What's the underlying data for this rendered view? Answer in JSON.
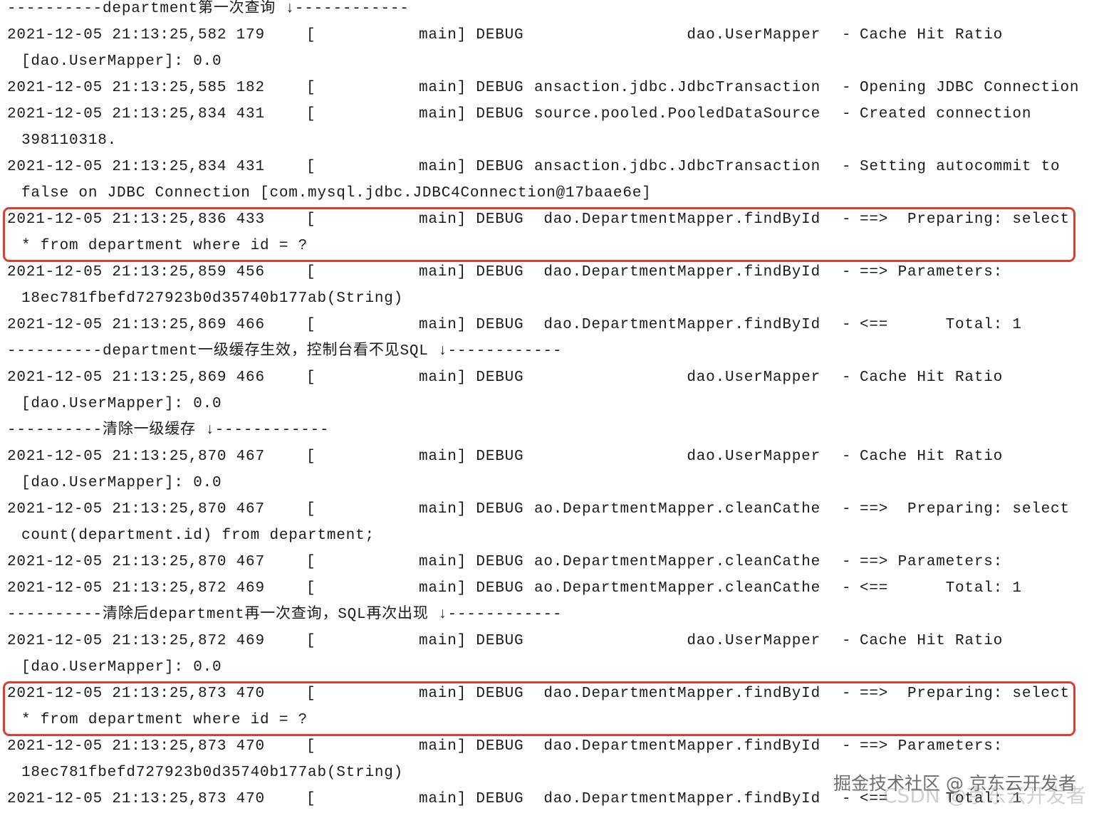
{
  "highlight_color": "#e23a2e",
  "watermarks": {
    "primary": "掘金技术社区 @ 京东云开发者",
    "secondary": "CSDN @京东云开发者"
  },
  "lines": [
    {
      "type": "sep",
      "text": "----------department第一次查询 ↓------------"
    },
    {
      "type": "entry",
      "ts": "2021-12-05 21:13:25,582 179",
      "bracket": "[",
      "thread": "main] DEBUG",
      "logger": "dao.UserMapper",
      "dash": "-",
      "msg": "Cache Hit Ratio"
    },
    {
      "type": "cont",
      "text": "[dao.UserMapper]: 0.0"
    },
    {
      "type": "entry",
      "ts": "2021-12-05 21:13:25,585 182",
      "bracket": "[",
      "thread": "main] DEBUG",
      "logger": "ansaction.jdbc.JdbcTransaction",
      "dash": "-",
      "msg": "Opening JDBC Connection"
    },
    {
      "type": "entry",
      "ts": "2021-12-05 21:13:25,834 431",
      "bracket": "[",
      "thread": "main] DEBUG",
      "logger": "source.pooled.PooledDataSource",
      "dash": "-",
      "msg": "Created connection"
    },
    {
      "type": "cont",
      "text": "398110318."
    },
    {
      "type": "entry",
      "ts": "2021-12-05 21:13:25,834 431",
      "bracket": "[",
      "thread": "main] DEBUG",
      "logger": "ansaction.jdbc.JdbcTransaction",
      "dash": "-",
      "msg": "Setting autocommit to"
    },
    {
      "type": "cont",
      "text": "false on JDBC Connection [com.mysql.jdbc.JDBC4Connection@17baae6e]"
    },
    {
      "type": "entry",
      "ts": "2021-12-05 21:13:25,836 433",
      "bracket": "[",
      "thread": "main] DEBUG",
      "logger": "dao.DepartmentMapper.findById",
      "dash": "-",
      "msg": "==>  Preparing: select",
      "highlight": true
    },
    {
      "type": "cont",
      "text": "* from department where id = ?"
    },
    {
      "type": "entry",
      "ts": "2021-12-05 21:13:25,859 456",
      "bracket": "[",
      "thread": "main] DEBUG",
      "logger": "dao.DepartmentMapper.findById",
      "dash": "-",
      "msg": "==> Parameters:"
    },
    {
      "type": "cont",
      "text": "18ec781fbefd727923b0d35740b177ab(String)"
    },
    {
      "type": "entry",
      "ts": "2021-12-05 21:13:25,869 466",
      "bracket": "[",
      "thread": "main] DEBUG",
      "logger": "dao.DepartmentMapper.findById",
      "dash": "-",
      "msg": "<==      Total: 1"
    },
    {
      "type": "sep",
      "text": "----------department一级缓存生效，控制台看不见SQL ↓------------"
    },
    {
      "type": "entry",
      "ts": "2021-12-05 21:13:25,869 466",
      "bracket": "[",
      "thread": "main] DEBUG",
      "logger": "dao.UserMapper",
      "dash": "-",
      "msg": "Cache Hit Ratio"
    },
    {
      "type": "cont",
      "text": "[dao.UserMapper]: 0.0"
    },
    {
      "type": "sep",
      "text": "----------清除一级缓存 ↓------------"
    },
    {
      "type": "entry",
      "ts": "2021-12-05 21:13:25,870 467",
      "bracket": "[",
      "thread": "main] DEBUG",
      "logger": "dao.UserMapper",
      "dash": "-",
      "msg": "Cache Hit Ratio"
    },
    {
      "type": "cont",
      "text": "[dao.UserMapper]: 0.0"
    },
    {
      "type": "entry",
      "ts": "2021-12-05 21:13:25,870 467",
      "bracket": "[",
      "thread": "main] DEBUG",
      "logger": "ao.DepartmentMapper.cleanCathe",
      "dash": "-",
      "msg": "==>  Preparing: select"
    },
    {
      "type": "cont",
      "text": "count(department.id) from department;"
    },
    {
      "type": "entry",
      "ts": "2021-12-05 21:13:25,870 467",
      "bracket": "[",
      "thread": "main] DEBUG",
      "logger": "ao.DepartmentMapper.cleanCathe",
      "dash": "-",
      "msg": "==> Parameters:"
    },
    {
      "type": "entry",
      "ts": "2021-12-05 21:13:25,872 469",
      "bracket": "[",
      "thread": "main] DEBUG",
      "logger": "ao.DepartmentMapper.cleanCathe",
      "dash": "-",
      "msg": "<==      Total: 1"
    },
    {
      "type": "sep",
      "text": "----------清除后department再一次查询，SQL再次出现 ↓------------"
    },
    {
      "type": "entry",
      "ts": "2021-12-05 21:13:25,872 469",
      "bracket": "[",
      "thread": "main] DEBUG",
      "logger": "dao.UserMapper",
      "dash": "-",
      "msg": "Cache Hit Ratio"
    },
    {
      "type": "cont",
      "text": "[dao.UserMapper]: 0.0"
    },
    {
      "type": "entry",
      "ts": "2021-12-05 21:13:25,873 470",
      "bracket": "[",
      "thread": "main] DEBUG",
      "logger": "dao.DepartmentMapper.findById",
      "dash": "-",
      "msg": "==>  Preparing: select",
      "highlight": true
    },
    {
      "type": "cont",
      "text": "* from department where id = ?"
    },
    {
      "type": "entry",
      "ts": "2021-12-05 21:13:25,873 470",
      "bracket": "[",
      "thread": "main] DEBUG",
      "logger": "dao.DepartmentMapper.findById",
      "dash": "-",
      "msg": "==> Parameters:"
    },
    {
      "type": "cont",
      "text": "18ec781fbefd727923b0d35740b177ab(String)"
    },
    {
      "type": "entry",
      "ts": "2021-12-05 21:13:25,873 470",
      "bracket": "[",
      "thread": "main] DEBUG",
      "logger": "dao.DepartmentMapper.findById",
      "dash": "-",
      "msg": "<==      Total: 1"
    }
  ]
}
